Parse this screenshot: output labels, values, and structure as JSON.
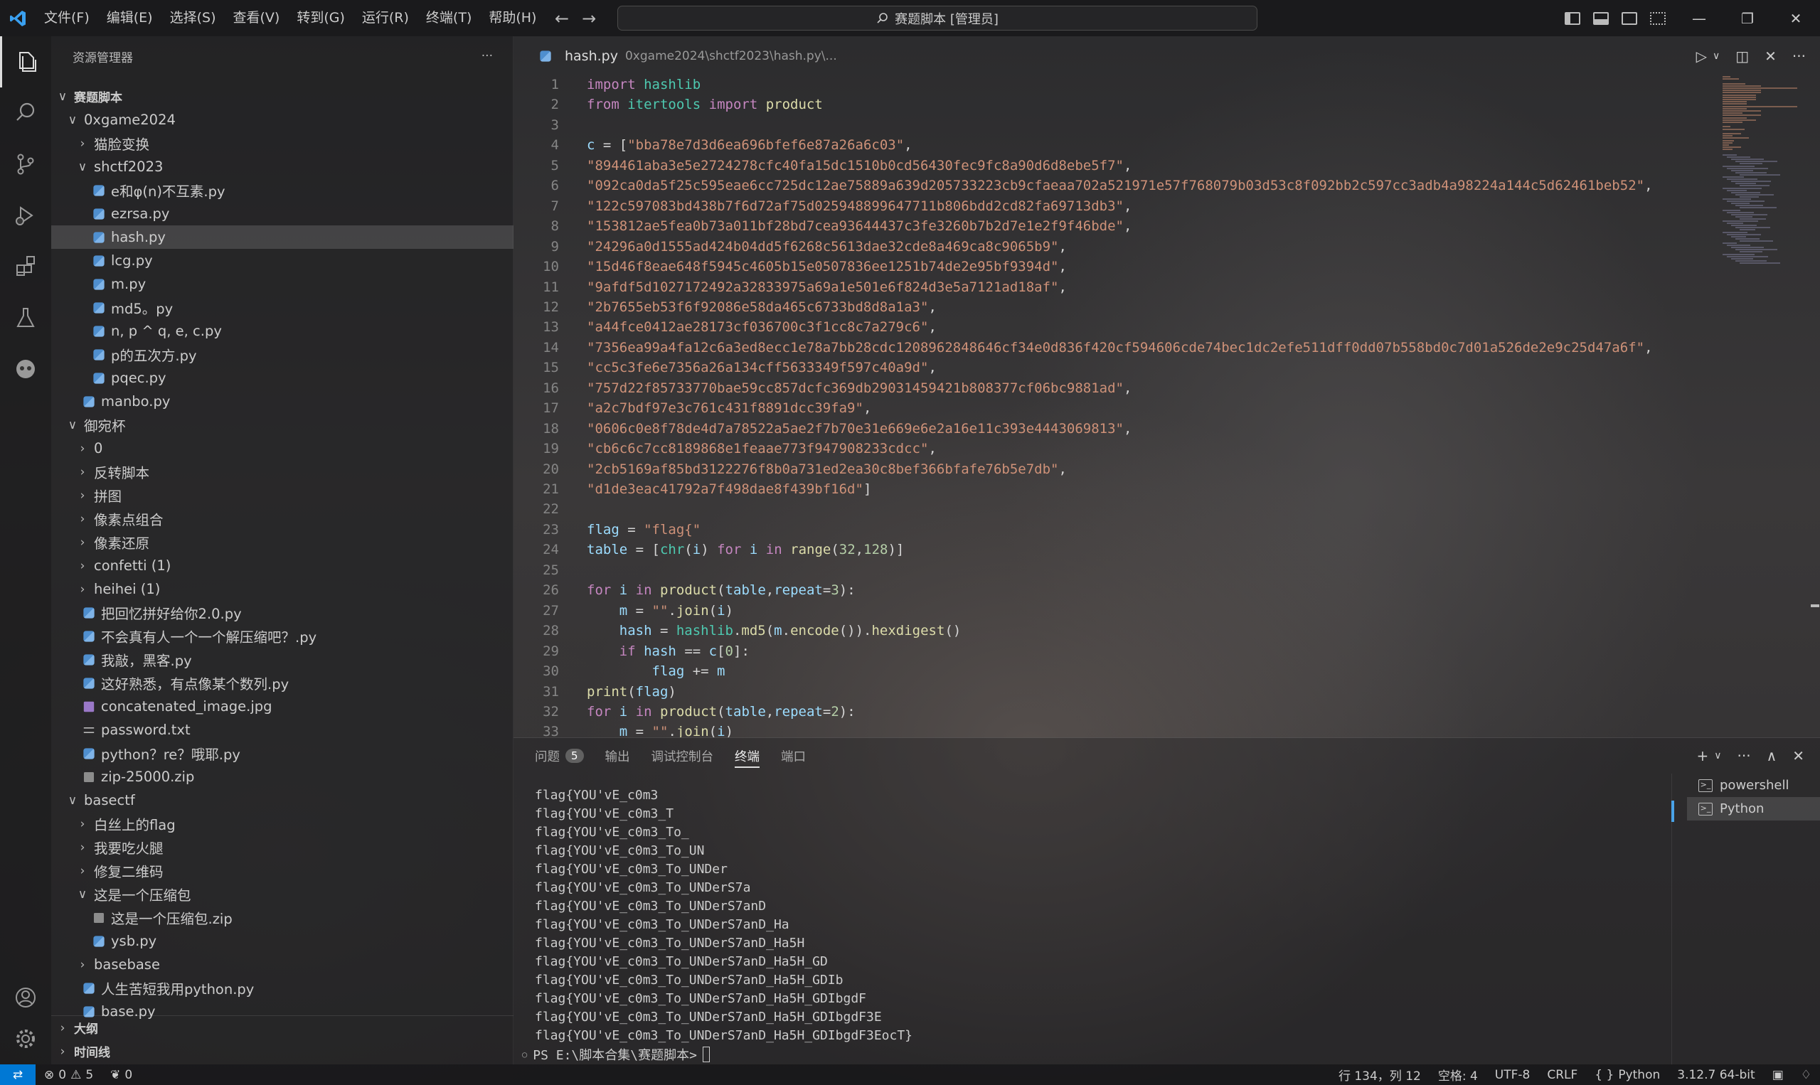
{
  "titlebar": {
    "menu": [
      "文件(F)",
      "编辑(E)",
      "选择(S)",
      "查看(V)",
      "转到(G)",
      "运行(R)",
      "终端(T)",
      "帮助(H)"
    ],
    "search_text": "赛题脚本 [管理员]"
  },
  "sidebar": {
    "title": "资源管理器",
    "more": "···",
    "rows": [
      {
        "label": "赛题脚本",
        "indent": 0,
        "type": "folder",
        "open": true,
        "bold": true
      },
      {
        "label": "0xgame2024",
        "indent": 1,
        "type": "folder",
        "open": true
      },
      {
        "label": "猫脸变换",
        "indent": 2,
        "type": "folder",
        "open": false
      },
      {
        "label": "shctf2023",
        "indent": 2,
        "type": "folder",
        "open": true
      },
      {
        "label": "e和φ(n)不互素.py",
        "indent": 3,
        "type": "py"
      },
      {
        "label": "ezrsa.py",
        "indent": 3,
        "type": "py"
      },
      {
        "label": "hash.py",
        "indent": 3,
        "type": "py",
        "selected": true
      },
      {
        "label": "lcg.py",
        "indent": 3,
        "type": "py"
      },
      {
        "label": "m.py",
        "indent": 3,
        "type": "py"
      },
      {
        "label": "md5。py",
        "indent": 3,
        "type": "py"
      },
      {
        "label": "n, p ^ q, e, c.py",
        "indent": 3,
        "type": "py"
      },
      {
        "label": "p的五次方.py",
        "indent": 3,
        "type": "py"
      },
      {
        "label": "pqec.py",
        "indent": 3,
        "type": "py"
      },
      {
        "label": "manbo.py",
        "indent": 2,
        "type": "py"
      },
      {
        "label": "御宛杯",
        "indent": 1,
        "type": "folder",
        "open": true
      },
      {
        "label": "0",
        "indent": 2,
        "type": "folder",
        "open": false
      },
      {
        "label": "反转脚本",
        "indent": 2,
        "type": "folder",
        "open": false
      },
      {
        "label": "拼图",
        "indent": 2,
        "type": "folder",
        "open": false
      },
      {
        "label": "像素点组合",
        "indent": 2,
        "type": "folder",
        "open": false
      },
      {
        "label": "像素还原",
        "indent": 2,
        "type": "folder",
        "open": false
      },
      {
        "label": "confetti (1)",
        "indent": 2,
        "type": "folder",
        "open": false
      },
      {
        "label": "heihei (1)",
        "indent": 2,
        "type": "folder",
        "open": false
      },
      {
        "label": "把回忆拼好给你2.0.py",
        "indent": 2,
        "type": "py"
      },
      {
        "label": "不会真有人一个一个解压缩吧？.py",
        "indent": 2,
        "type": "py"
      },
      {
        "label": "我敲，黑客.py",
        "indent": 2,
        "type": "py"
      },
      {
        "label": "这好熟悉，有点像某个数列.py",
        "indent": 2,
        "type": "py"
      },
      {
        "label": "concatenated_image.jpg",
        "indent": 2,
        "type": "img"
      },
      {
        "label": "password.txt",
        "indent": 2,
        "type": "txt"
      },
      {
        "label": "python？re？哦耶.py",
        "indent": 2,
        "type": "py"
      },
      {
        "label": "zip-25000.zip",
        "indent": 2,
        "type": "zip"
      },
      {
        "label": "basectf",
        "indent": 1,
        "type": "folder",
        "open": true
      },
      {
        "label": "白丝上的flag",
        "indent": 2,
        "type": "folder",
        "open": false
      },
      {
        "label": "我要吃火腿",
        "indent": 2,
        "type": "folder",
        "open": false
      },
      {
        "label": "修复二维码",
        "indent": 2,
        "type": "folder",
        "open": false
      },
      {
        "label": "这是一个压缩包",
        "indent": 2,
        "type": "folder",
        "open": true
      },
      {
        "label": "这是一个压缩包.zip",
        "indent": 3,
        "type": "zip"
      },
      {
        "label": "ysb.py",
        "indent": 3,
        "type": "py"
      },
      {
        "label": "basebase",
        "indent": 2,
        "type": "folder",
        "open": false
      },
      {
        "label": "人生苦短我用python.py",
        "indent": 2,
        "type": "py"
      },
      {
        "label": "base.py",
        "indent": 2,
        "type": "py"
      }
    ],
    "sections": [
      "大纲",
      "时间线"
    ]
  },
  "tab": {
    "name": "hash.py",
    "path": "0xgame2024\\shctf2023\\hash.py\\..."
  },
  "code": [
    [
      [
        "kw",
        "import"
      ],
      [
        "t",
        " "
      ],
      [
        "cls",
        "hashlib"
      ]
    ],
    [
      [
        "kw",
        "from"
      ],
      [
        "t",
        " "
      ],
      [
        "cls",
        "itertools"
      ],
      [
        "t",
        " "
      ],
      [
        "kw",
        "import"
      ],
      [
        "t",
        " "
      ],
      [
        "fn",
        "product"
      ]
    ],
    [],
    [
      [
        "var",
        "c"
      ],
      [
        "t",
        " = ["
      ],
      [
        "str",
        "\"bba78e7d3d6ea696bfef6e87a26a6c03\""
      ],
      [
        "t",
        ","
      ]
    ],
    [
      [
        "str",
        "\"894461aba3e5e2724278cfc40fa15dc1510b0cd56430fec9fc8a90d6d8ebe5f7\""
      ],
      [
        "t",
        ","
      ]
    ],
    [
      [
        "str",
        "\"092ca0da5f25c595eae6cc725dc12ae75889a639d205733223cb9cfaeaa702a521971e57f768079b03d53c8f092bb2c597cc3adb4a98224a144c5d62461beb52\""
      ],
      [
        "t",
        ","
      ]
    ],
    [
      [
        "str",
        "\"122c597083bd438b7f6d72af75d025948899647711b806bdd2cd82fa69713db3\""
      ],
      [
        "t",
        ","
      ]
    ],
    [
      [
        "str",
        "\"153812ae5fea0b73a011bf28bd7cea93644437c3fe3260b7b2d7e1e2f9f46bde\""
      ],
      [
        "t",
        ","
      ]
    ],
    [
      [
        "str",
        "\"24296a0d1555ad424b04dd5f6268c5613dae32cde8a469ca8c9065b9\""
      ],
      [
        "t",
        ","
      ]
    ],
    [
      [
        "str",
        "\"15d46f8eae648f5945c4605b15e0507836ee1251b74de2e95bf9394d\""
      ],
      [
        "t",
        ","
      ]
    ],
    [
      [
        "str",
        "\"9afdf5d1027172492a32833975a69a1e501e6f824d3e5a7121ad18af\""
      ],
      [
        "t",
        ","
      ]
    ],
    [
      [
        "str",
        "\"2b7655eb53f6f92086e58da465c6733bd8d8a1a3\""
      ],
      [
        "t",
        ","
      ]
    ],
    [
      [
        "str",
        "\"a44fce0412ae28173cf036700c3f1cc8c7a279c6\""
      ],
      [
        "t",
        ","
      ]
    ],
    [
      [
        "str",
        "\"7356ea99a4fa12c6a3ed8ecc1e78a7bb28cdc1208962848646cf34e0d836f420cf594606cde74bec1dc2efe511dff0dd07b558bd0c7d01a526de2e9c25d47a6f\""
      ],
      [
        "t",
        ","
      ]
    ],
    [
      [
        "str",
        "\"cc5c3fe6e7356a26a134cff5633349f597c40a9d\""
      ],
      [
        "t",
        ","
      ]
    ],
    [
      [
        "str",
        "\"757d22f85733770bae59cc857dcfc369db29031459421b808377cf06bc9881ad\""
      ],
      [
        "t",
        ","
      ]
    ],
    [
      [
        "str",
        "\"a2c7bdf97e3c761c431f8891dcc39fa9\""
      ],
      [
        "t",
        ","
      ]
    ],
    [
      [
        "str",
        "\"0606c0e8f78de4d7a78522a5ae2f7b70e31e669e6e2a16e11c393e4443069813\""
      ],
      [
        "t",
        ","
      ]
    ],
    [
      [
        "str",
        "\"cb6c6c7cc8189868e1feaae773f947908233cdcc\""
      ],
      [
        "t",
        ","
      ]
    ],
    [
      [
        "str",
        "\"2cb5169af85bd3122276f8b0a731ed2ea30c8bef366bfafe76b5e7db\""
      ],
      [
        "t",
        ","
      ]
    ],
    [
      [
        "str",
        "\"d1de3eac41792a7f498dae8f439bf16d\""
      ],
      [
        "t",
        "]"
      ]
    ],
    [],
    [
      [
        "var",
        "flag"
      ],
      [
        "t",
        " = "
      ],
      [
        "str",
        "\"flag{\""
      ]
    ],
    [
      [
        "var",
        "table"
      ],
      [
        "t",
        " = ["
      ],
      [
        "cls",
        "chr"
      ],
      [
        "t",
        "("
      ],
      [
        "var",
        "i"
      ],
      [
        "t",
        ") "
      ],
      [
        "kw",
        "for"
      ],
      [
        "t",
        " "
      ],
      [
        "var",
        "i"
      ],
      [
        "t",
        " "
      ],
      [
        "kw",
        "in"
      ],
      [
        "t",
        " "
      ],
      [
        "fn",
        "range"
      ],
      [
        "t",
        "("
      ],
      [
        "num",
        "32"
      ],
      [
        "t",
        ","
      ],
      [
        "num",
        "128"
      ],
      [
        "t",
        ")]"
      ]
    ],
    [],
    [
      [
        "kw",
        "for"
      ],
      [
        "t",
        " "
      ],
      [
        "var",
        "i"
      ],
      [
        "t",
        " "
      ],
      [
        "kw",
        "in"
      ],
      [
        "t",
        " "
      ],
      [
        "fn",
        "product"
      ],
      [
        "t",
        "("
      ],
      [
        "var",
        "table"
      ],
      [
        "t",
        ","
      ],
      [
        "var",
        "repeat"
      ],
      [
        "t",
        "="
      ],
      [
        "num",
        "3"
      ],
      [
        "t",
        "):"
      ]
    ],
    [
      [
        "t",
        "    "
      ],
      [
        "var",
        "m"
      ],
      [
        "t",
        " = "
      ],
      [
        "str",
        "\"\""
      ],
      [
        "t",
        "."
      ],
      [
        "fn",
        "join"
      ],
      [
        "t",
        "("
      ],
      [
        "var",
        "i"
      ],
      [
        "t",
        ")"
      ]
    ],
    [
      [
        "t",
        "    "
      ],
      [
        "var",
        "hash"
      ],
      [
        "t",
        " = "
      ],
      [
        "cls",
        "hashlib"
      ],
      [
        "t",
        "."
      ],
      [
        "fn",
        "md5"
      ],
      [
        "t",
        "("
      ],
      [
        "var",
        "m"
      ],
      [
        "t",
        "."
      ],
      [
        "fn",
        "encode"
      ],
      [
        "t",
        "())."
      ],
      [
        "fn",
        "hexdigest"
      ],
      [
        "t",
        "()"
      ]
    ],
    [
      [
        "t",
        "    "
      ],
      [
        "kw",
        "if"
      ],
      [
        "t",
        " "
      ],
      [
        "var",
        "hash"
      ],
      [
        "t",
        " == "
      ],
      [
        "var",
        "c"
      ],
      [
        "t",
        "["
      ],
      [
        "num",
        "0"
      ],
      [
        "t",
        "]:"
      ]
    ],
    [
      [
        "t",
        "        "
      ],
      [
        "var",
        "flag"
      ],
      [
        "t",
        " += "
      ],
      [
        "var",
        "m"
      ]
    ],
    [
      [
        "fn",
        "print"
      ],
      [
        "t",
        "("
      ],
      [
        "var",
        "flag"
      ],
      [
        "t",
        ")"
      ]
    ],
    [
      [
        "kw",
        "for"
      ],
      [
        "t",
        " "
      ],
      [
        "var",
        "i"
      ],
      [
        "t",
        " "
      ],
      [
        "kw",
        "in"
      ],
      [
        "t",
        " "
      ],
      [
        "fn",
        "product"
      ],
      [
        "t",
        "("
      ],
      [
        "var",
        "table"
      ],
      [
        "t",
        ","
      ],
      [
        "var",
        "repeat"
      ],
      [
        "t",
        "="
      ],
      [
        "num",
        "2"
      ],
      [
        "t",
        "):"
      ]
    ],
    [
      [
        "t",
        "    "
      ],
      [
        "var",
        "m"
      ],
      [
        "t",
        " = "
      ],
      [
        "str",
        "\"\""
      ],
      [
        "t",
        "."
      ],
      [
        "fn",
        "join"
      ],
      [
        "t",
        "("
      ],
      [
        "var",
        "i"
      ],
      [
        "t",
        ")"
      ]
    ]
  ],
  "panel": {
    "tabs": [
      {
        "label": "问题",
        "badge": "5"
      },
      {
        "label": "输出"
      },
      {
        "label": "调试控制台"
      },
      {
        "label": "终端",
        "active": true
      },
      {
        "label": "端口"
      }
    ],
    "output": [
      "flag{YOU'vE_c0m3",
      "flag{YOU'vE_c0m3_T",
      "flag{YOU'vE_c0m3_To_",
      "flag{YOU'vE_c0m3_To_UN",
      "flag{YOU'vE_c0m3_To_UNDer",
      "flag{YOU'vE_c0m3_To_UNDerS7a",
      "flag{YOU'vE_c0m3_To_UNDerS7anD",
      "flag{YOU'vE_c0m3_To_UNDerS7anD_Ha",
      "flag{YOU'vE_c0m3_To_UNDerS7anD_Ha5H",
      "flag{YOU'vE_c0m3_To_UNDerS7anD_Ha5H_GD",
      "flag{YOU'vE_c0m3_To_UNDerS7anD_Ha5H_GDIb",
      "flag{YOU'vE_c0m3_To_UNDerS7anD_Ha5H_GDIbgdF",
      "flag{YOU'vE_c0m3_To_UNDerS7anD_Ha5H_GDIbgdF3E",
      "flag{YOU'vE_c0m3_To_UNDerS7anD_Ha5H_GDIbgdF3EocT}"
    ],
    "prompt": "PS E:\\脚本合集\\赛题脚本>",
    "terminals": [
      {
        "label": "powershell"
      },
      {
        "label": "Python",
        "active": true
      }
    ]
  },
  "statusbar": {
    "errors": "0",
    "warnings": "5",
    "ports": "0",
    "position": "行 134，列 12",
    "spaces": "空格: 4",
    "encoding": "UTF-8",
    "eol": "CRLF",
    "language": "Python",
    "interpreter": "3.12.7 64-bit"
  }
}
